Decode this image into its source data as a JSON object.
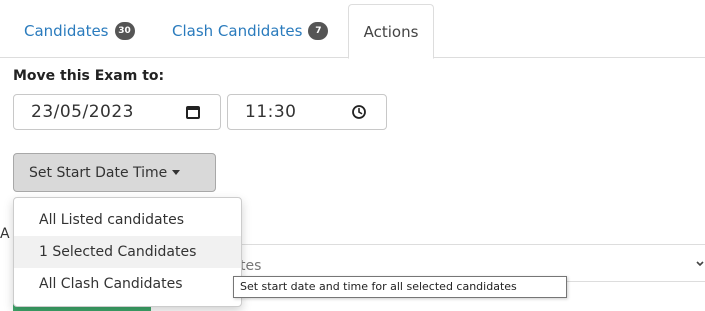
{
  "tabs": [
    {
      "label": "Candidates",
      "badge": "30"
    },
    {
      "label": "Clash Candidates",
      "badge": "7"
    },
    {
      "label": "Actions"
    }
  ],
  "move": {
    "label": "Move this Exam to:",
    "date_value": "23/05/2023",
    "time_value": "11:30"
  },
  "set_start_button": {
    "label": "Set Start Date Time"
  },
  "dropdown": {
    "items": [
      {
        "label": "All Listed candidates"
      },
      {
        "label": "1 Selected Candidates"
      },
      {
        "label": "All Clash Candidates"
      }
    ]
  },
  "background": {
    "partial_label": "A",
    "select_text": "tes"
  },
  "tooltip": {
    "text": "Set start date and time for all selected candidates"
  },
  "colors": {
    "accent": "#2a7bbd",
    "badge": "#555555",
    "success": "#3ea66a"
  }
}
